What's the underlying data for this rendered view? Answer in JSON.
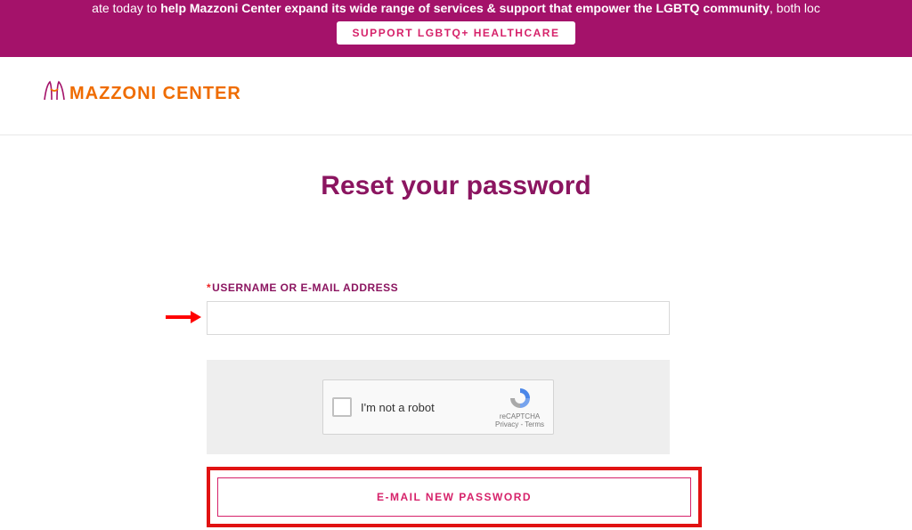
{
  "banner": {
    "text_prefix": "ate today to ",
    "text_bold": "help Mazzoni Center expand its wide range of services & support that empower the LGBTQ community",
    "text_suffix": ", both loc",
    "button_label": "SUPPORT LGBTQ+ HEALTHCARE"
  },
  "logo": {
    "text": "MAZZONI CENTER"
  },
  "page": {
    "title": "Reset your password"
  },
  "form": {
    "username_label": "USERNAME OR E-MAIL ADDRESS",
    "username_value": "",
    "recaptcha_label": "I'm not a robot",
    "recaptcha_brand": "reCAPTCHA",
    "recaptcha_links": "Privacy - Terms",
    "submit_label": "E-MAIL NEW PASSWORD"
  }
}
